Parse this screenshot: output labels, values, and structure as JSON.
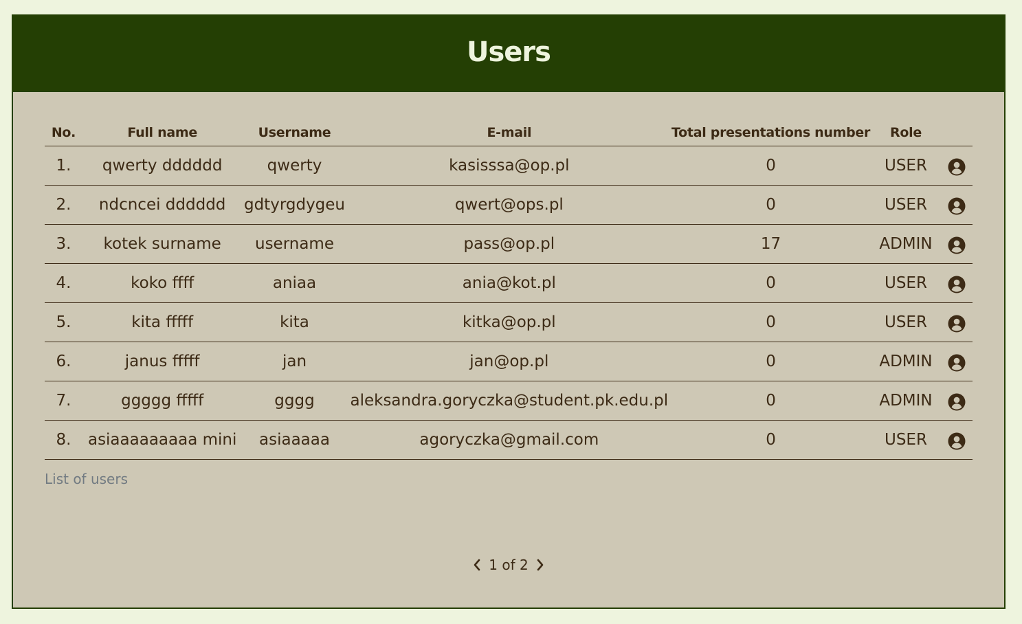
{
  "header": {
    "title": "Users"
  },
  "table": {
    "columns": [
      "No.",
      "Full name",
      "Username",
      "E-mail",
      "Total presentations number",
      "Role"
    ],
    "rows": [
      {
        "no": "1.",
        "full_name": "qwerty dddddd",
        "username": "qwerty",
        "email": "kasisssa@op.pl",
        "presentations": "0",
        "role": "USER",
        "icon": "user-circle-icon"
      },
      {
        "no": "2.",
        "full_name": "ndcncei dddddd",
        "username": "gdtyrgdygeu",
        "email": "qwert@ops.pl",
        "presentations": "0",
        "role": "USER",
        "icon": "user-circle-icon"
      },
      {
        "no": "3.",
        "full_name": "kotek surname",
        "username": "username",
        "email": "pass@op.pl",
        "presentations": "17",
        "role": "ADMIN",
        "icon": "user-circle-icon"
      },
      {
        "no": "4.",
        "full_name": "koko ffff",
        "username": "aniaa",
        "email": "ania@kot.pl",
        "presentations": "0",
        "role": "USER",
        "icon": "user-circle-icon"
      },
      {
        "no": "5.",
        "full_name": "kita fffff",
        "username": "kita",
        "email": "kitka@op.pl",
        "presentations": "0",
        "role": "USER",
        "icon": "user-circle-icon"
      },
      {
        "no": "6.",
        "full_name": "janus fffff",
        "username": "jan",
        "email": "jan@op.pl",
        "presentations": "0",
        "role": "ADMIN",
        "icon": "user-circle-icon"
      },
      {
        "no": "7.",
        "full_name": "ggggg fffff",
        "username": "gggg",
        "email": "aleksandra.goryczka@student.pk.edu.pl",
        "presentations": "0",
        "role": "ADMIN",
        "icon": "user-circle-icon"
      },
      {
        "no": "8.",
        "full_name": "asiaaaaaaaaa mini",
        "username": "asiaaaaa",
        "email": "agoryczka@gmail.com",
        "presentations": "0",
        "role": "USER",
        "icon": "user-circle-icon"
      }
    ],
    "caption": "List of users"
  },
  "pagination": {
    "label": "1 of 2",
    "prev_icon": "chevron-left-icon",
    "next_icon": "chevron-right-icon"
  },
  "colors": {
    "page_background": "#eef4de",
    "header_background": "#243f04",
    "panel_background": "#cec8b5",
    "text": "#3d2b16",
    "caption_text": "#727b82"
  }
}
